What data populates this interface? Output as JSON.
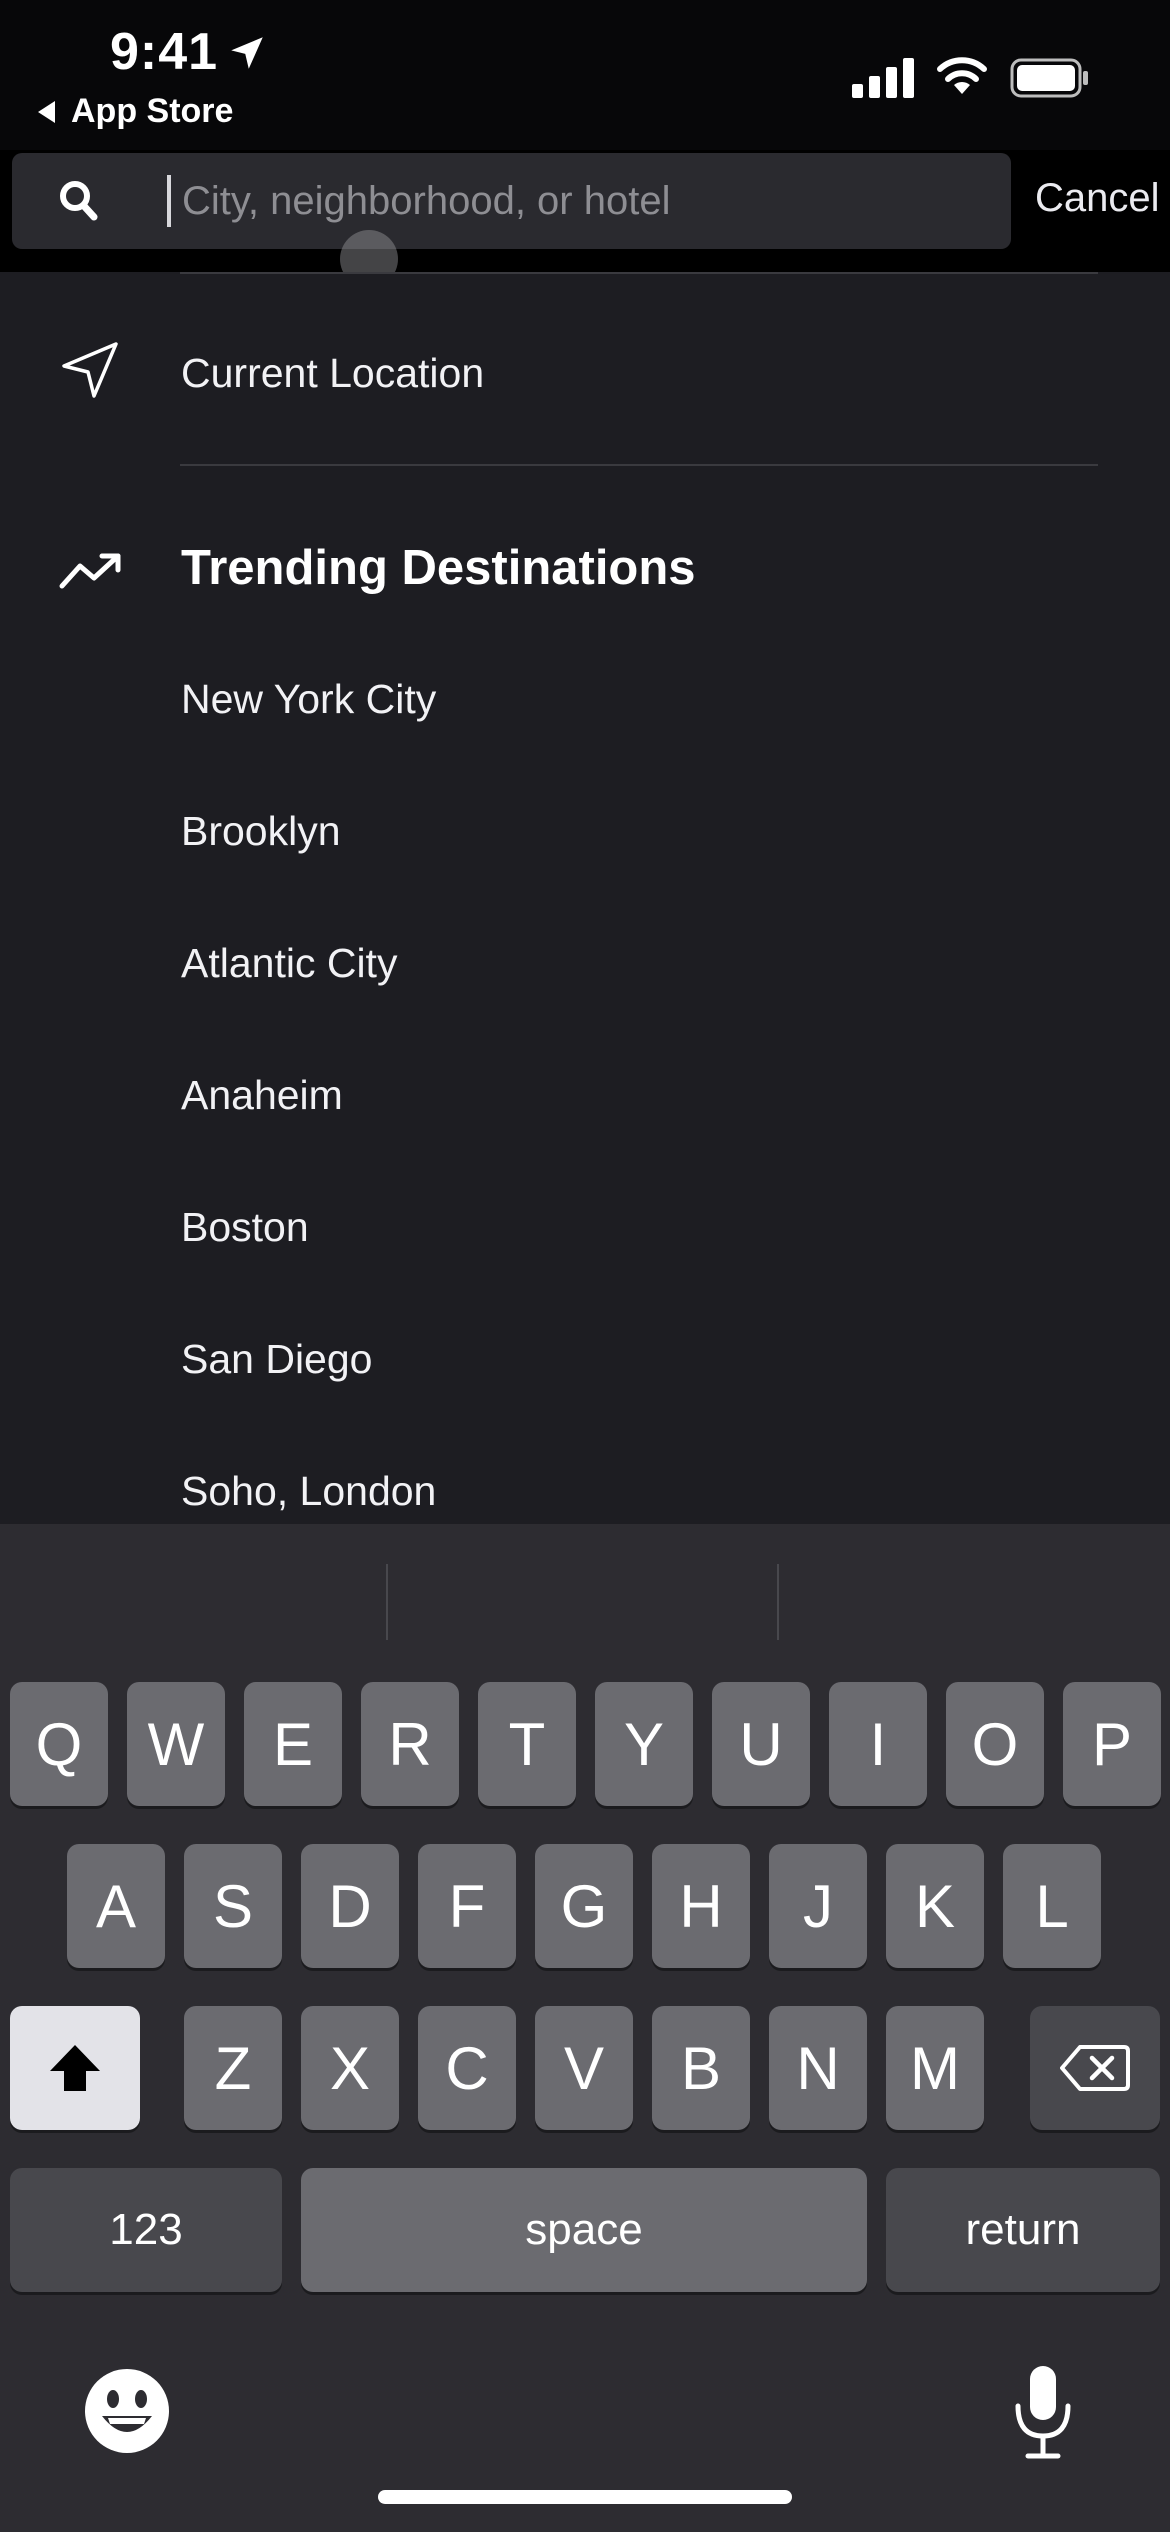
{
  "status_bar": {
    "time": "9:41",
    "back_label": "App Store",
    "icons": [
      "location-arrow-icon",
      "signal-icon",
      "wifi-icon",
      "battery-icon"
    ]
  },
  "search": {
    "placeholder": "City, neighborhood, or hotel",
    "value": "",
    "cancel_label": "Cancel"
  },
  "current_location": {
    "label": "Current Location",
    "icon": "navigation-arrow-icon"
  },
  "trending": {
    "title": "Trending Destinations",
    "icon": "trending-up-icon",
    "items": [
      "New York City",
      "Brooklyn",
      "Atlantic City",
      "Anaheim",
      "Boston",
      "San Diego",
      "Soho, London"
    ]
  },
  "keyboard": {
    "row1": [
      "Q",
      "W",
      "E",
      "R",
      "T",
      "Y",
      "U",
      "I",
      "O",
      "P"
    ],
    "row2": [
      "A",
      "S",
      "D",
      "F",
      "G",
      "H",
      "J",
      "K",
      "L"
    ],
    "row3": [
      "Z",
      "X",
      "C",
      "V",
      "B",
      "N",
      "M"
    ],
    "numbers_label": "123",
    "space_label": "space",
    "return_label": "return",
    "icons": [
      "shift-icon",
      "backspace-icon",
      "emoji-icon",
      "microphone-icon"
    ]
  },
  "colors": {
    "background": "#1d1d22",
    "search_field": "#2a2a2f",
    "keyboard": "#2d2c31",
    "key": "#6b6b70",
    "key_dark": "#48484d"
  }
}
